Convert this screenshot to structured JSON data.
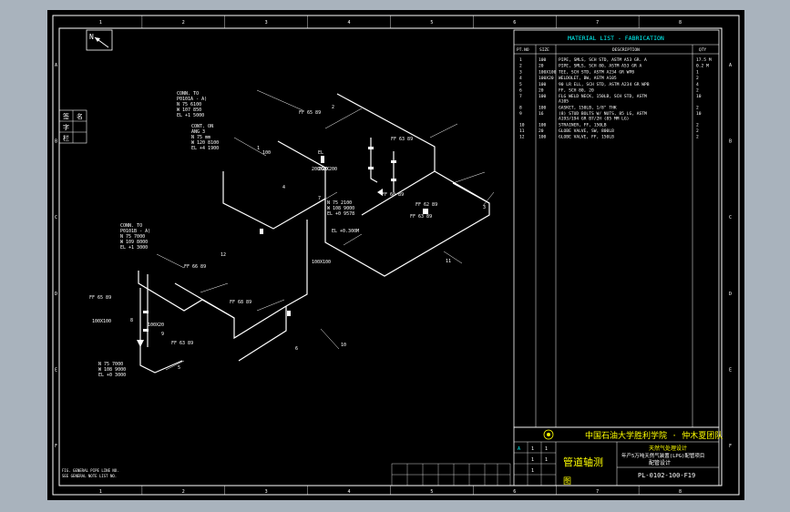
{
  "drawing": {
    "north_label": "N",
    "border_top_numbers": [
      "1",
      "2",
      "3",
      "4",
      "5",
      "6",
      "7",
      "8"
    ],
    "border_bottom_numbers": [
      "1",
      "2",
      "3",
      "4",
      "5",
      "6",
      "7",
      "8"
    ],
    "border_side_letters": [
      "A",
      "B",
      "C",
      "D",
      "E",
      "F"
    ],
    "left_side_labels": [
      "签",
      "字",
      "栏",
      "名"
    ]
  },
  "annotations": {
    "conn_top": [
      "CONN. TO",
      "P0101A - A)",
      "N 75 6100",
      "W 107 850",
      "EL +1 5000"
    ],
    "cont": [
      "CONT. ON",
      "ANG 3",
      "N 75 mm",
      "W 120 8100",
      "EL +4 1900"
    ],
    "conn_left": [
      "CONN. TO",
      "P0101B - A)",
      "N 75 7000",
      "W 109 8000",
      "EL +1 3000"
    ],
    "coord_mid": [
      "N 75 2100",
      "W 108 9000",
      "EL +0 9578"
    ],
    "coord_bottom": [
      "N 75 7000",
      "W 108 9000",
      "EL +0 3000"
    ],
    "el_dims": [
      "EL",
      "200X20"
    ],
    "el_right": "EL +0.300M",
    "ff_tags": [
      "FF 65 89",
      "FF 63 89",
      "FF 60 89",
      "FF 62 89",
      "FF 63 89",
      "FF 66 89",
      "FF 68 89",
      "FF 65 89",
      "FF 63 89"
    ],
    "pipe_sizes": [
      "100",
      "200X200",
      "100X100",
      "100X20",
      "100X100"
    ],
    "item_numbers": [
      "1",
      "2",
      "3",
      "4",
      "5",
      "6",
      "7",
      "8",
      "9",
      "10",
      "11",
      "12"
    ],
    "bottom_notes": [
      "FIG. GENERAL PIPE LINE NO.",
      "SEE GENERAL NOTE LIST NO."
    ]
  },
  "material_list": {
    "title": "MATERIAL LIST - FABRICATION",
    "headers": [
      "PT.NO",
      "SIZE",
      "DESCRIPTION",
      "QTY"
    ],
    "rows": [
      {
        "pt": "1",
        "size": "100",
        "desc": "PIPE, SMLS, SCH STD, ASTM A53 GR. A",
        "qty": "17.5 M"
      },
      {
        "pt": "2",
        "size": "20",
        "desc": "PIPE, SMLS, SCH 80, ASTM A53 GR A",
        "qty": "0.2 M"
      },
      {
        "pt": "3",
        "size": "100X100",
        "desc": "TEE, SCH STD, ASTM A234 GR WPB",
        "qty": "1"
      },
      {
        "pt": "4",
        "size": "100X20",
        "desc": "WELDOLET, BW, ASTM A105",
        "qty": "2"
      },
      {
        "pt": "5",
        "size": "100",
        "desc": "90 LR ELL, SCH STD, ASTM A234 GR WPB",
        "qty": "4"
      },
      {
        "pt": "6",
        "size": "20",
        "desc": "FF, SCH 80, 20",
        "qty": "2"
      },
      {
        "pt": "7",
        "size": "100",
        "desc": "FLG WELD NECK, 150LB, SCH STD, ASTM A105",
        "qty": "10"
      },
      {
        "pt": "8",
        "size": "100",
        "desc": "GASKET, 150LB, 1/8\" THK",
        "qty": "2"
      },
      {
        "pt": "9",
        "size": "16",
        "desc": "(8) STUD BOLTS W/ NUTS, 85 LG, ASTM A193/194 GR B7/2H (85 MM LG)",
        "qty": "10"
      },
      {
        "pt": "10",
        "size": "100",
        "desc": "STRAINER, FF, 150LB",
        "qty": "2"
      },
      {
        "pt": "11",
        "size": "20",
        "desc": "GLOBE VALVE, SW, 800LB",
        "qty": "2"
      },
      {
        "pt": "12",
        "size": "100",
        "desc": "GLOBE VALVE, FF, 150LB",
        "qty": "2"
      }
    ]
  },
  "title_block": {
    "school_line": "中国石油大学胜利学院 · 仲木夏团队",
    "project_line1": "天然气处理设计",
    "project_line2": "年产5万吨天然气装置(LPG)配管项目",
    "project_line3": "配管设计",
    "drawing_name": "管道轴测",
    "drawing_name_sub": "图",
    "drawing_number": "PL-0102-100-F19",
    "rev_cells": [
      "A",
      "1",
      "1",
      "1",
      "1",
      "1"
    ]
  },
  "colors": {
    "background": "#a9b3bd",
    "canvas": "#000000",
    "line": "#ffffff",
    "title_yellow": "#ffff00",
    "accent_cyan": "#00ffff"
  }
}
